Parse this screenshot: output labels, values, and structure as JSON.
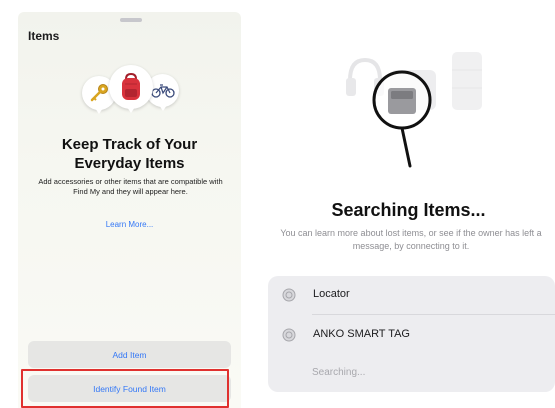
{
  "left": {
    "section_title": "Items",
    "headline": "Keep Track of Your Everyday Items",
    "description": "Add accessories or other items that are compatible with Find My and they will appear here.",
    "learn_more": "Learn More...",
    "add_item_label": "Add Item",
    "identify_label": "Identify Found Item",
    "icons": [
      "key-icon",
      "backpack-icon",
      "bicycle-icon"
    ],
    "highlight_color": "#e0312f",
    "accent_color": "#3478f6"
  },
  "right": {
    "title": "Searching Items...",
    "subtitle": "You can learn more about lost items, or see if the owner has left a message, by connecting to it.",
    "items": [
      {
        "name": "Locator",
        "icon": "tracker-icon"
      },
      {
        "name": "ANKO SMART TAG",
        "icon": "tracker-icon"
      }
    ],
    "status": "Searching..."
  }
}
